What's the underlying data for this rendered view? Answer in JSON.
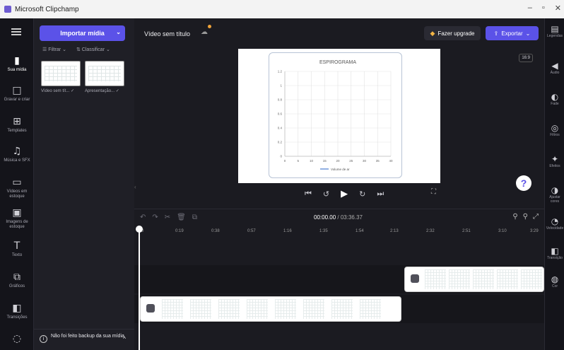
{
  "window": {
    "title": "Microsoft Clipchamp",
    "controls": [
      "–",
      "▫",
      "✕"
    ]
  },
  "left_rail": [
    {
      "label": "Sua mídia",
      "icon": "media-folder-icon"
    },
    {
      "label": "Gravar e criar",
      "icon": "record-camera-icon"
    },
    {
      "label": "Templates",
      "icon": "templates-icon"
    },
    {
      "label": "Música e SFX",
      "icon": "music-note-icon"
    },
    {
      "label": "Vídeos em estoque",
      "icon": "stock-video-icon"
    },
    {
      "label": "Imagens de estoque",
      "icon": "stock-image-icon"
    },
    {
      "label": "Texto",
      "icon": "text-icon"
    },
    {
      "label": "Gráficos",
      "icon": "graphics-icon"
    },
    {
      "label": "Transições",
      "icon": "transitions-icon"
    }
  ],
  "media_panel": {
    "import_label": "Importar mídia",
    "filter_label": "Filtrar",
    "sort_label": "Classificar",
    "items": [
      {
        "label": "Vídeo sem tít..."
      },
      {
        "label": "Apresentação..."
      }
    ],
    "backup_text": "Não foi feito backup da sua mídia"
  },
  "topbar": {
    "project_title": "Vídeo sem título",
    "upgrade_label": "Fazer upgrade",
    "export_label": "Exportar"
  },
  "preview": {
    "aspect_ratio": "16:9",
    "chart_data": {
      "type": "line",
      "title": "ESPIROGRAMA",
      "xlabel": "",
      "ylabel": "",
      "x_ticks": [
        "0",
        "5",
        "10",
        "15",
        "20",
        "25",
        "30",
        "35",
        "40"
      ],
      "y_ticks": [
        "0",
        "0.2",
        "0.4",
        "0.6",
        "0.8",
        "1",
        "1.2"
      ],
      "ylim": [
        0,
        1.2
      ],
      "xlim": [
        0,
        40
      ],
      "grid": true,
      "legend": "bottom",
      "series": [
        {
          "name": "Volume de ar",
          "values": []
        }
      ]
    }
  },
  "timeline": {
    "current_time": "00:00.00",
    "total_time": "/ 03:36.37",
    "ruler_ticks": [
      "0",
      "0:19",
      "0:38",
      "0:57",
      "1:16",
      "1:35",
      "1:54",
      "2:13",
      "2:32",
      "2:51",
      "3:10",
      "3:29"
    ]
  },
  "right_rail": [
    {
      "label": "Legendas",
      "icon": "captions-icon"
    },
    {
      "label": "Áudio",
      "icon": "audio-icon"
    },
    {
      "label": "Fade",
      "icon": "fade-icon"
    },
    {
      "label": "Filtros",
      "icon": "filters-icon"
    },
    {
      "label": "Efeitos",
      "icon": "effects-icon"
    },
    {
      "label": "Ajustar cores",
      "icon": "adjust-colors-icon"
    },
    {
      "label": "Velocidade",
      "icon": "speed-icon"
    },
    {
      "label": "Transição",
      "icon": "transition-icon"
    },
    {
      "label": "Cor",
      "icon": "color-icon"
    }
  ]
}
